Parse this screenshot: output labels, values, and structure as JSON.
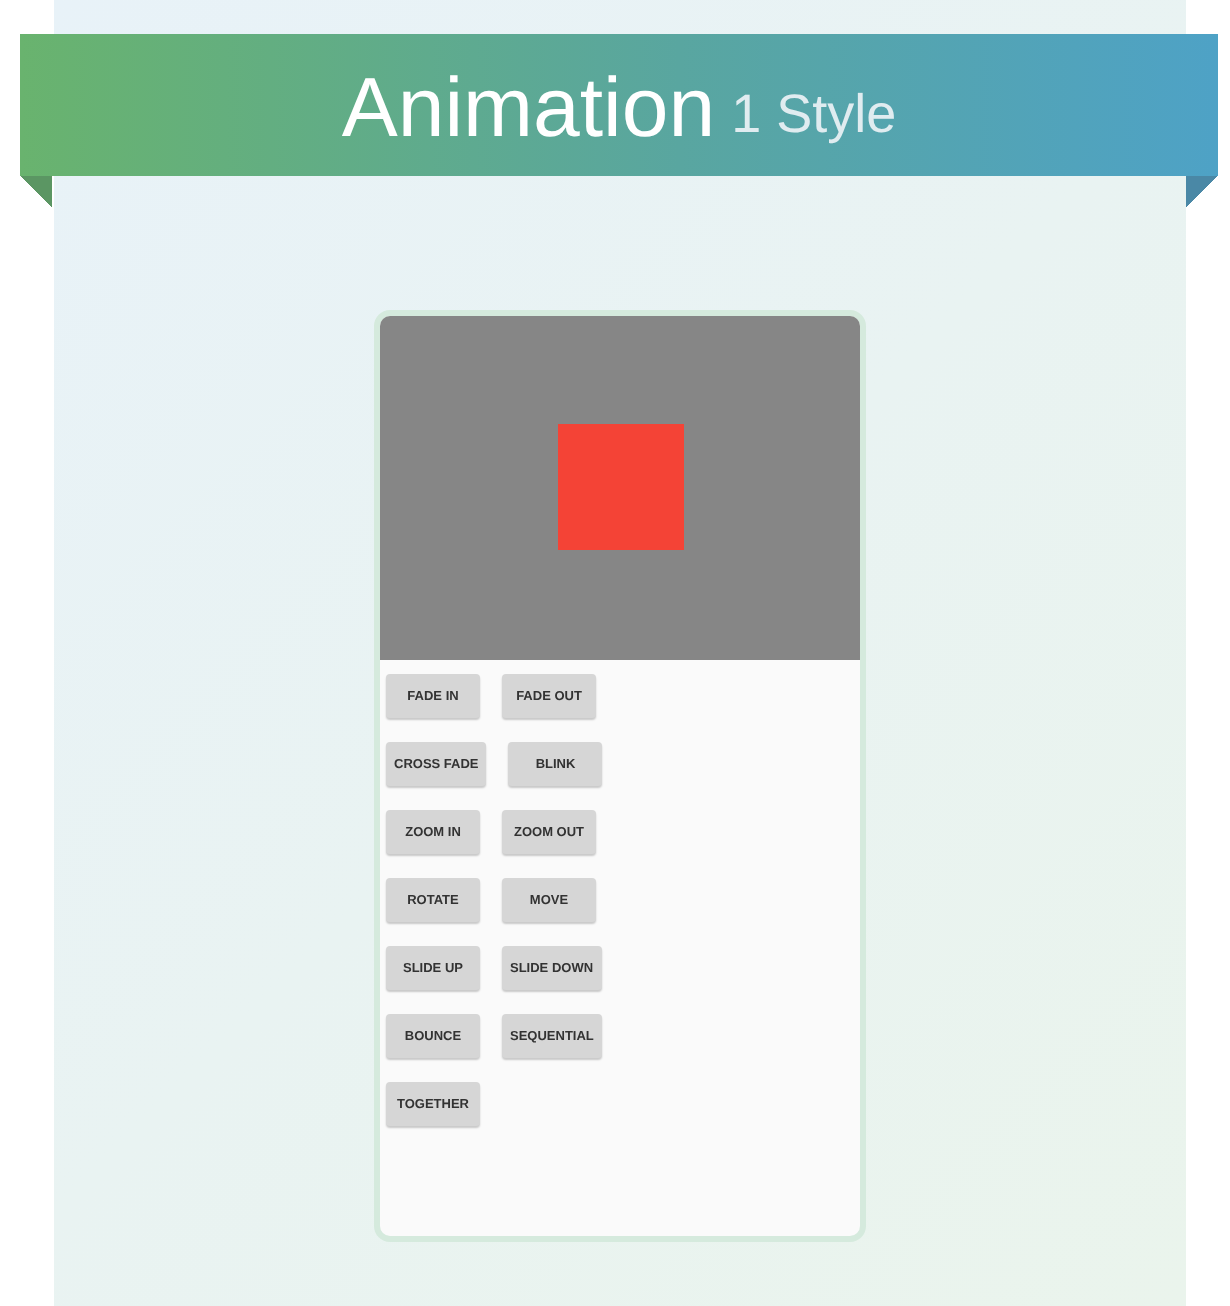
{
  "banner": {
    "title": "Animation",
    "subtitle": "1 Style"
  },
  "preview": {
    "kind": "picture"
  },
  "button_rows": [
    [
      "FADE IN",
      "FADE OUT"
    ],
    [
      "CROSS FADE",
      "BLINK"
    ],
    [
      "ZOOM IN",
      "ZOOM OUT"
    ],
    [
      "ROTATE",
      "MOVE"
    ],
    [
      "SLIDE UP",
      "SLIDE DOWN"
    ],
    [
      "BOUNCE",
      "SEQUENTIAL"
    ],
    [
      "TOGETHER"
    ]
  ]
}
